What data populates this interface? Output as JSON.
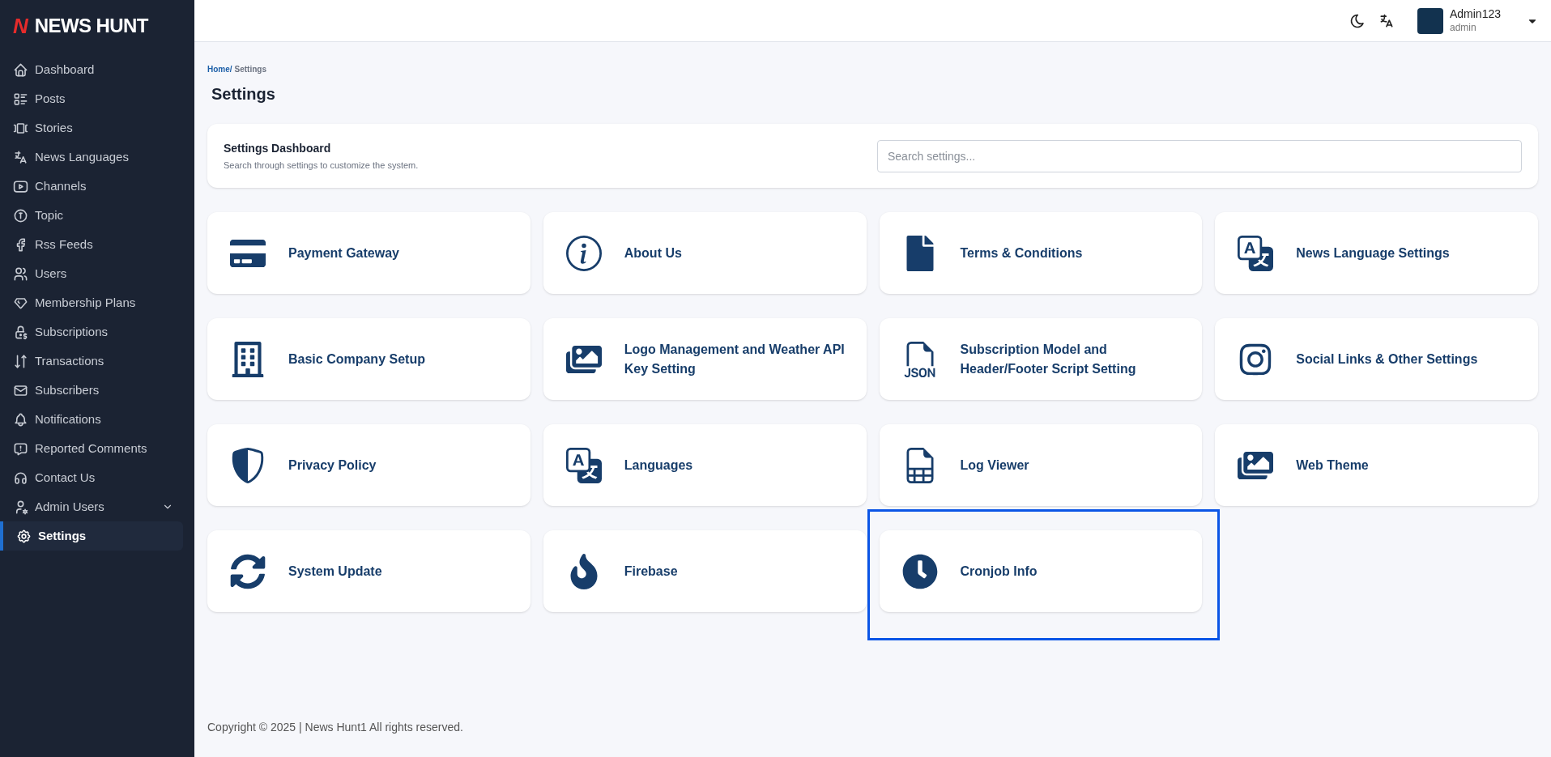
{
  "brand": {
    "logo_mark": "N",
    "title": "NEWS HUNT"
  },
  "sidebar": {
    "items": [
      {
        "label": "Dashboard",
        "selected": false
      },
      {
        "label": "Posts",
        "selected": false
      },
      {
        "label": "Stories",
        "selected": false
      },
      {
        "label": "News Languages",
        "selected": false
      },
      {
        "label": "Channels",
        "selected": false
      },
      {
        "label": "Topic",
        "selected": false
      },
      {
        "label": "Rss Feeds",
        "selected": false
      },
      {
        "label": "Users",
        "selected": false
      },
      {
        "label": "Membership Plans",
        "selected": false
      },
      {
        "label": "Subscriptions",
        "selected": false
      },
      {
        "label": "Transactions",
        "selected": false
      },
      {
        "label": "Subscribers",
        "selected": false
      },
      {
        "label": "Notifications",
        "selected": false
      },
      {
        "label": "Reported Comments",
        "selected": false
      },
      {
        "label": "Contact Us",
        "selected": false
      },
      {
        "label": "Admin Users",
        "selected": false,
        "expandable": true
      },
      {
        "label": "Settings",
        "selected": true
      }
    ]
  },
  "header": {
    "user": {
      "name": "Admin123",
      "role": "admin"
    }
  },
  "breadcrumb": {
    "home": "Home/",
    "current": "Settings"
  },
  "page_title": "Settings",
  "dashboard": {
    "title": "Settings Dashboard",
    "subtitle": "Search through settings to customize the system.",
    "search": {
      "placeholder": "Search settings..."
    }
  },
  "cards": [
    {
      "label": "Payment Gateway",
      "highlighted": false
    },
    {
      "label": "About Us",
      "highlighted": false
    },
    {
      "label": "Terms & Conditions",
      "highlighted": false
    },
    {
      "label": "News Language Settings",
      "highlighted": false
    },
    {
      "label": "Basic Company Setup",
      "highlighted": false
    },
    {
      "label": "Logo Management and Weather API Key Setting",
      "highlighted": false
    },
    {
      "label": "Subscription Model and Header/Footer Script Setting",
      "highlighted": false
    },
    {
      "label": "Social Links & Other Settings",
      "highlighted": false
    },
    {
      "label": "Privacy Policy",
      "highlighted": false
    },
    {
      "label": "Languages",
      "highlighted": false
    },
    {
      "label": "Log Viewer",
      "highlighted": false
    },
    {
      "label": "Web Theme",
      "highlighted": false
    },
    {
      "label": "System Update",
      "highlighted": false
    },
    {
      "label": "Firebase",
      "highlighted": false
    },
    {
      "label": "Cronjob Info",
      "highlighted": true
    }
  ],
  "footer": "Copyright © 2025 | News Hunt1 All rights reserved."
}
